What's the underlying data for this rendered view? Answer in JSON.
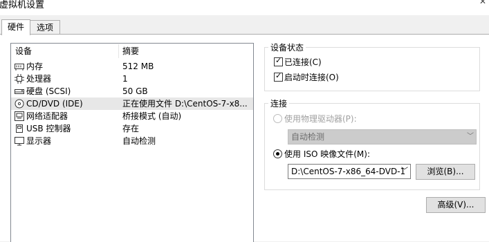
{
  "window": {
    "title": "虚拟机设置"
  },
  "tabs": [
    {
      "label": "硬件",
      "active": true
    },
    {
      "label": "选项",
      "active": false
    }
  ],
  "device_list": {
    "headers": {
      "device": "设备",
      "summary": "摘要"
    },
    "rows": [
      {
        "icon": "memory-icon",
        "name": "内存",
        "summary": "512 MB",
        "selected": false
      },
      {
        "icon": "processor-icon",
        "name": "处理器",
        "summary": "1",
        "selected": false
      },
      {
        "icon": "hard-disk-icon",
        "name": "硬盘 (SCSI)",
        "summary": "50 GB",
        "selected": false
      },
      {
        "icon": "cd-dvd-icon",
        "name": "CD/DVD (IDE)",
        "summary": "正在使用文件 D:\\CentOS-7-x8...",
        "selected": true
      },
      {
        "icon": "network-adapter-icon",
        "name": "网络适配器",
        "summary": "桥接模式 (自动)",
        "selected": false
      },
      {
        "icon": "usb-controller-icon",
        "name": "USB 控制器",
        "summary": "存在",
        "selected": false
      },
      {
        "icon": "display-icon",
        "name": "显示器",
        "summary": "自动检测",
        "selected": false
      }
    ]
  },
  "device_status": {
    "legend": "设备状态",
    "connected": {
      "label": "已连接(C)",
      "checked": true
    },
    "connect_at_power_on": {
      "label": "启动时连接(O)",
      "checked": true
    }
  },
  "connection": {
    "legend": "连接",
    "physical_drive": {
      "label": "使用物理驱动器(P):",
      "selected": false,
      "enabled": false
    },
    "physical_drive_select": {
      "value": "自动检测",
      "enabled": false
    },
    "iso_image": {
      "label": "使用 ISO 映像文件(M):",
      "selected": true
    },
    "iso_path": {
      "value": "D:\\CentOS-7-x86_64-DVD-1"
    },
    "browse_button": "浏览(B)..."
  },
  "advanced_button": "高级(V)..."
}
